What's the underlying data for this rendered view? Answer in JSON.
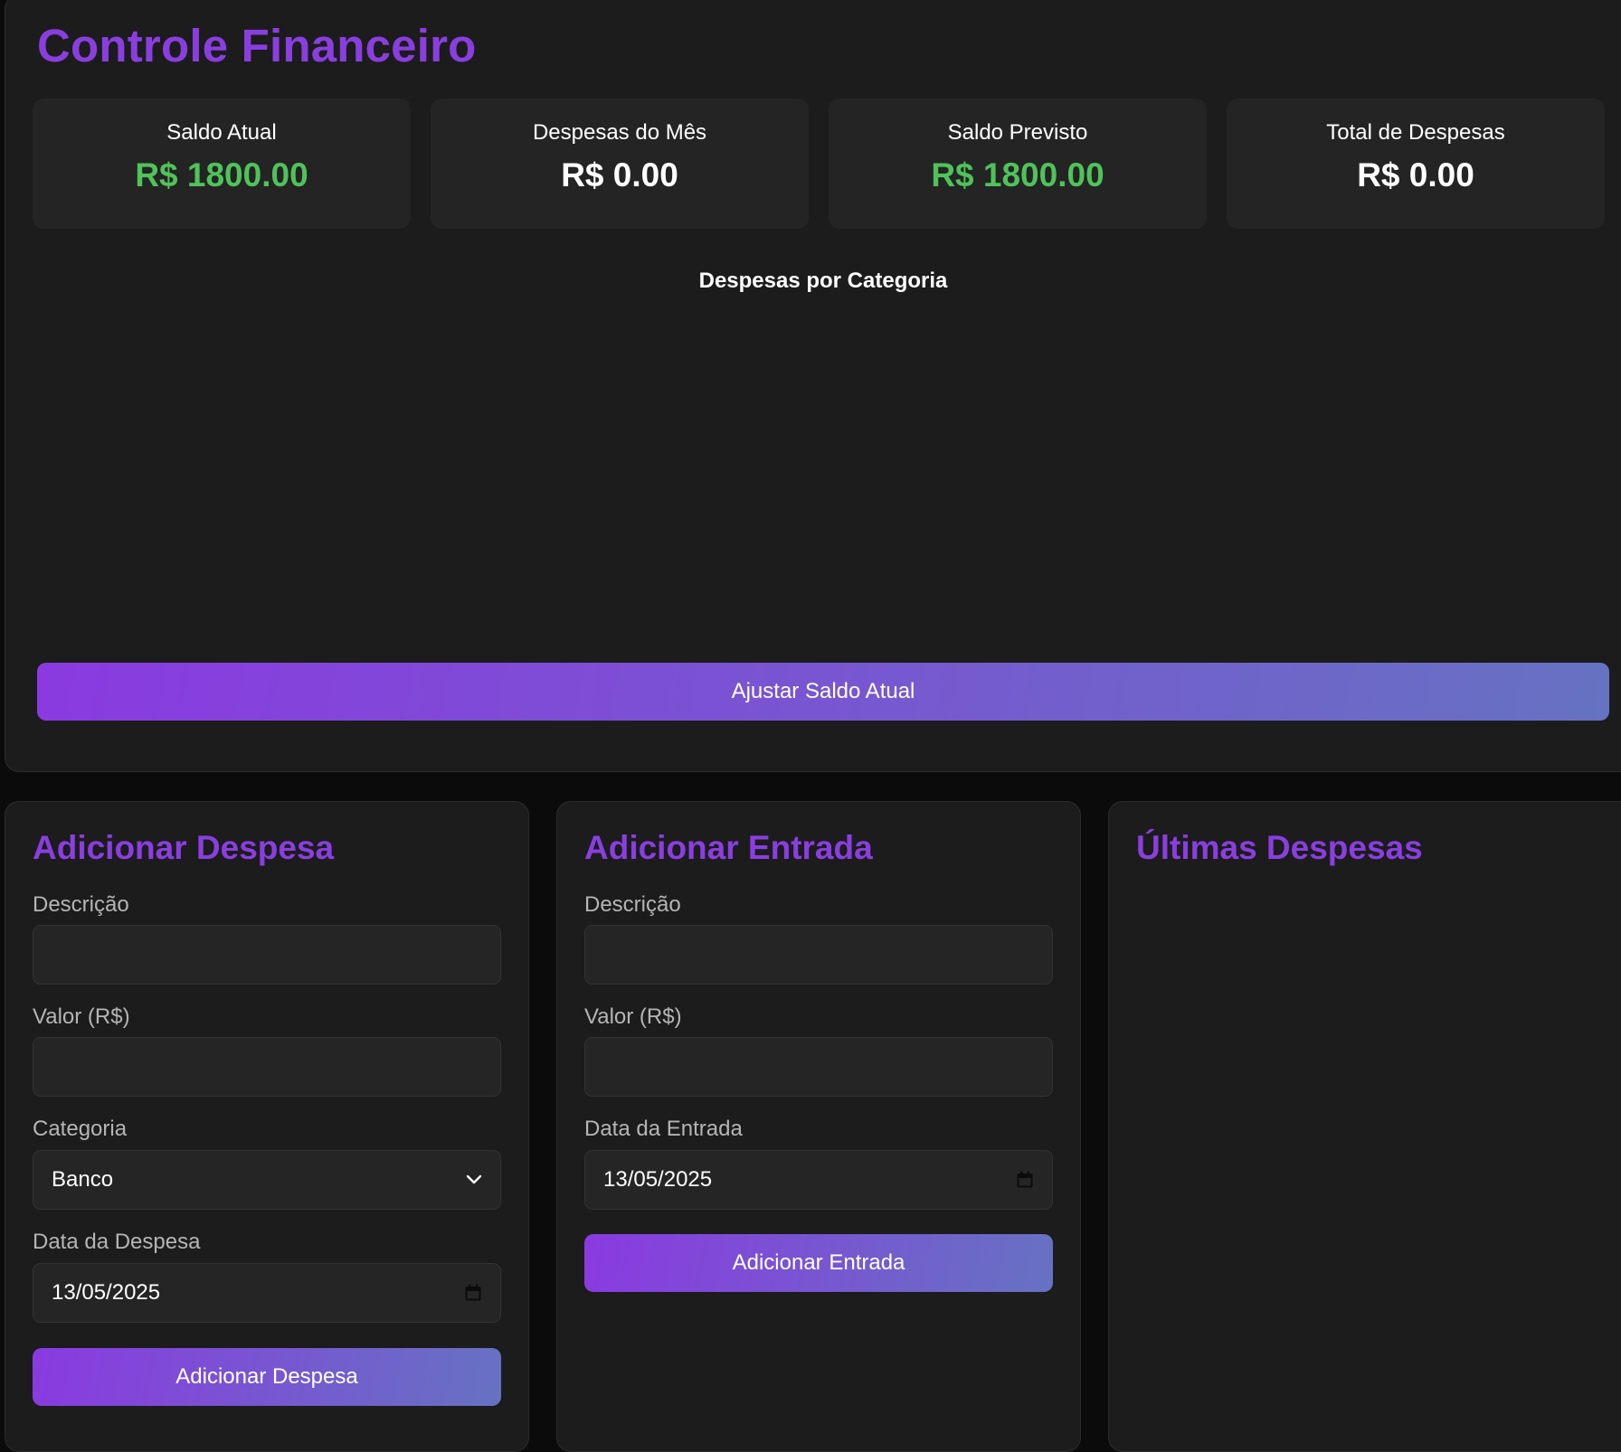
{
  "header": {
    "title": "Controle Financeiro"
  },
  "summary": [
    {
      "label": "Saldo Atual",
      "value": "R$ 1800.00"
    },
    {
      "label": "Despesas do Mês",
      "value": "R$ 0.00"
    },
    {
      "label": "Saldo Previsto",
      "value": "R$ 1800.00"
    },
    {
      "label": "Total de Despesas",
      "value": "R$ 0.00"
    }
  ],
  "chart": {
    "title": "Despesas por Categoria"
  },
  "adjust_button": "Ajustar Saldo Atual",
  "expense_form": {
    "title": "Adicionar Despesa",
    "description_label": "Descrição",
    "description_value": "",
    "amount_label": "Valor (R$)",
    "amount_value": "",
    "category_label": "Categoria",
    "category_value": "Banco",
    "date_label": "Data da Despesa",
    "date_value": "13/05/2025",
    "submit_label": "Adicionar Despesa"
  },
  "income_form": {
    "title": "Adicionar Entrada",
    "description_label": "Descrição",
    "description_value": "",
    "amount_label": "Valor (R$)",
    "amount_value": "",
    "date_label": "Data da Entrada",
    "date_value": "13/05/2025",
    "submit_label": "Adicionar Entrada"
  },
  "recent": {
    "title": "Últimas Despesas"
  },
  "colors": {
    "accent": "#8a3ee0",
    "positive": "#4fc35a",
    "gradient_start": "#8a3ae0",
    "gradient_end": "#6672c2",
    "panel": "#1c1c1c",
    "background": "#0b0b0b"
  },
  "icons": {
    "select": "chevron-down-icon",
    "date": "calendar-icon"
  }
}
